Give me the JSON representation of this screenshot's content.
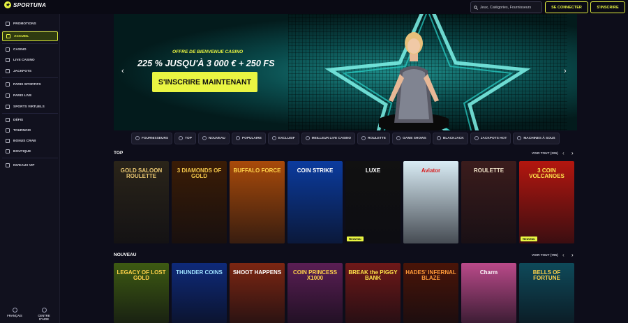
{
  "header": {
    "logo_text": "SPORTUNA",
    "search_placeholder": "Jeux, Catégories, Fournisseurs",
    "login_label": "SE CONNECTER",
    "signup_label": "S'INSCRIRE"
  },
  "sidebar": {
    "items": [
      {
        "label": "PROMOTIONS",
        "icon": "gift-icon"
      },
      {
        "label": "ACCUEIL",
        "icon": "home-icon",
        "active": true
      },
      {
        "label": "CASINO",
        "icon": "casino-icon"
      },
      {
        "label": "LIVE CASINO",
        "icon": "live-casino-icon"
      },
      {
        "label": "JACKPOTS",
        "icon": "jackpot-icon"
      },
      {
        "label": "PARIS SPORTIFS",
        "icon": "sports-icon"
      },
      {
        "label": "PARIS LIVE",
        "icon": "live-bets-icon"
      },
      {
        "label": "SPORTS VIRTUELS",
        "icon": "virtual-sports-icon"
      },
      {
        "label": "DÉFIS",
        "icon": "challenge-icon"
      },
      {
        "label": "TOURNOIS",
        "icon": "trophy-icon"
      },
      {
        "label": "BONUS CRAB",
        "icon": "crab-icon"
      },
      {
        "label": "BOUTIQUE",
        "icon": "shop-icon"
      },
      {
        "label": "NIVEAUX VIP",
        "icon": "diamond-icon"
      }
    ],
    "footer": {
      "language": "FRANÇAIS",
      "help": "CENTRE D'AIDE"
    }
  },
  "banner": {
    "subtitle": "OFFRE DE BIENVENUE CASINO",
    "title": "225 % JUSQU'À 3 000 € + 250 FS",
    "cta": "S'INSCRIRE MAINTENANT"
  },
  "categories": [
    "FOURNISSEURS",
    "TOP",
    "NOUVEAU",
    "POPULAIRE",
    "EXCLUSIF",
    "MEILLEUR LIVE CASINO",
    "ROULETTE",
    "GAME SHOWS",
    "BLACKJACK",
    "JACKPOTS HOT",
    "MACHINES À SOUS"
  ],
  "sections": {
    "top": {
      "title": "TOP",
      "link": "VOIR TOUT (326)"
    },
    "nouveau": {
      "title": "NOUVEAU",
      "link": "VOIR TOUT (795)"
    }
  },
  "top_games": [
    {
      "name": "GOLD SALOON ROULETTE",
      "bg": "#2a2419",
      "color": "#e8c671"
    },
    {
      "name": "3 DIAMONDS OF GOLD",
      "bg": "#3a1c06",
      "color": "#f2c64a"
    },
    {
      "name": "BUFFALO FORCE",
      "bg": "#a84a0a",
      "color": "#ffd24a"
    },
    {
      "name": "COIN STRIKE",
      "bg": "#0b3b9e",
      "color": "#ffffff"
    },
    {
      "name": "LUXE",
      "bg": "#111111",
      "color": "#ffffff",
      "badge": "Nouveau"
    },
    {
      "name": "Aviator",
      "bg": "#d9ecf5",
      "color": "#d71e1e"
    },
    {
      "name": "ROULETTE",
      "bg": "#3b1c1c",
      "color": "#f0e2c8"
    },
    {
      "name": "3 COIN VOLCANOES",
      "bg": "#b3160f",
      "color": "#ffe34a",
      "badge": "Nouveau"
    }
  ],
  "new_games": [
    {
      "name": "LEGACY OF LOST GOLD",
      "bg": "#3d5a12",
      "color": "#ffd24a"
    },
    {
      "name": "THUNDER COINS",
      "bg": "#0e2a7a",
      "color": "#9fe2ff"
    },
    {
      "name": "SHOOT HAPPENS",
      "bg": "#7c2612",
      "color": "#ffffff"
    },
    {
      "name": "COIN PRINCESS X1000",
      "bg": "#5a1e54",
      "color": "#ffd24a"
    },
    {
      "name": "BREAK the PIGGY BANK",
      "bg": "#6e1818",
      "color": "#ffe34a"
    },
    {
      "name": "HADES' INFERNAL BLAZE",
      "bg": "#4a1408",
      "color": "#ff9a3a"
    },
    {
      "name": "Charm",
      "bg": "#ba4a8a",
      "color": "#ffffff"
    },
    {
      "name": "BELLS OF FORTUNE",
      "bg": "#0e4a5a",
      "color": "#ffd24a"
    }
  ],
  "accent_color": "#e9f542"
}
